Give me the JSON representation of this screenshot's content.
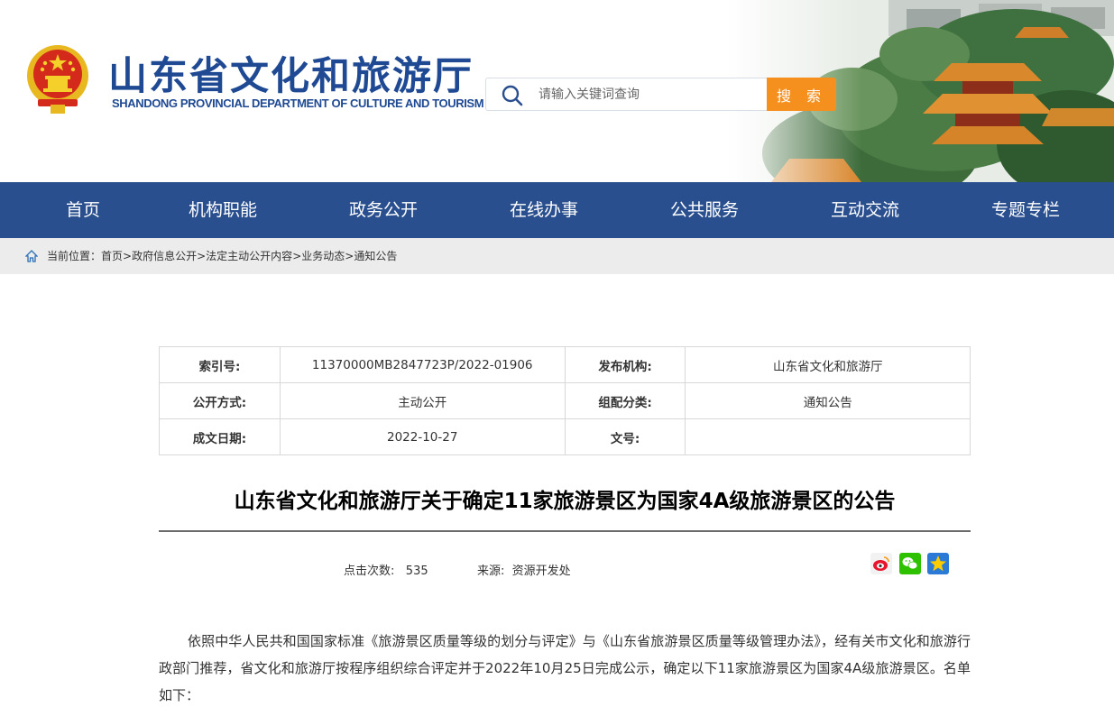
{
  "header": {
    "title": "山东省文化和旅游厅",
    "subtitle": "SHANDONG PROVINCIAL DEPARTMENT OF CULTURE AND TOURISM",
    "search_placeholder": "请输入关键词查询",
    "search_button": "搜 索"
  },
  "nav": {
    "items": [
      {
        "label": "首页"
      },
      {
        "label": "机构职能"
      },
      {
        "label": "政务公开"
      },
      {
        "label": "在线办事"
      },
      {
        "label": "公共服务"
      },
      {
        "label": "互动交流"
      },
      {
        "label": "专题专栏"
      }
    ]
  },
  "breadcrumb": {
    "prefix": "当前位置：",
    "items": [
      "首页",
      "政府信息公开",
      "法定主动公开内容",
      "业务动态",
      "通知公告"
    ],
    "separator": ">"
  },
  "info": {
    "rows": [
      {
        "k1": "索引号:",
        "v1": "11370000MB2847723P/2022-01906",
        "k2": "发布机构:",
        "v2": "山东省文化和旅游厅"
      },
      {
        "k1": "公开方式:",
        "v1": "主动公开",
        "k2": "组配分类:",
        "v2": "通知公告"
      },
      {
        "k1": "成文日期:",
        "v1": "2022-10-27",
        "k2": "文号:",
        "v2": ""
      }
    ]
  },
  "article": {
    "title": "山东省文化和旅游厅关于确定11家旅游景区为国家4A级旅游景区的公告",
    "hits_label": "点击次数:",
    "hits_value": "535",
    "source_label": "来源:",
    "source_value": "资源开发处",
    "body": "依照中华人民共和国国家标准《旅游景区质量等级的划分与评定》与《山东省旅游景区质量等级管理办法》，经有关市文化和旅游行政部门推荐，省文化和旅游厅按程序组织综合评定并于2022年10月25日完成公示，确定以下11家旅游景区为国家4A级旅游景区。名单如下："
  },
  "share": {
    "icons": [
      "weibo-icon",
      "wechat-icon",
      "qzone-icon"
    ]
  },
  "colors": {
    "brand_blue": "#1f4a93",
    "nav_blue": "#2a4f8f",
    "search_orange": "#f5901e",
    "breadcrumb_bg": "#ececec"
  }
}
